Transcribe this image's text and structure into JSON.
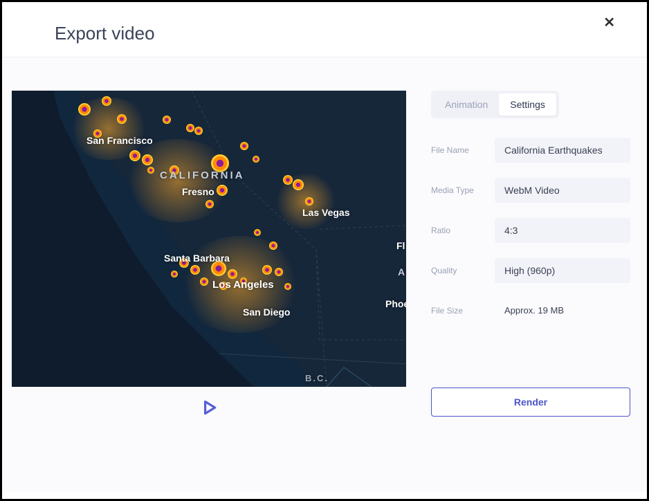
{
  "header": {
    "title": "Export video"
  },
  "tabs": {
    "animation": "Animation",
    "settings": "Settings",
    "active": "settings"
  },
  "fields": {
    "fileName": {
      "label": "File Name",
      "value": "California Earthquakes"
    },
    "mediaType": {
      "label": "Media Type",
      "value": "WebM Video"
    },
    "ratio": {
      "label": "Ratio",
      "value": "4:3"
    },
    "quality": {
      "label": "Quality",
      "value": "High (960p)"
    },
    "fileSize": {
      "label": "File Size",
      "value": "Approx. 19 MB"
    }
  },
  "actions": {
    "render": "Render"
  },
  "map": {
    "labels": {
      "sf": "San Francisco",
      "california": "CALIFORNIA",
      "fresno": "Fresno",
      "vegas": "Las Vegas",
      "sb": "Santa Barbara",
      "la": "Los Angeles",
      "sd": "San Diego",
      "phx": "Phoe",
      "fl": "Fl",
      "a": "A",
      "bc": "B.C."
    }
  }
}
